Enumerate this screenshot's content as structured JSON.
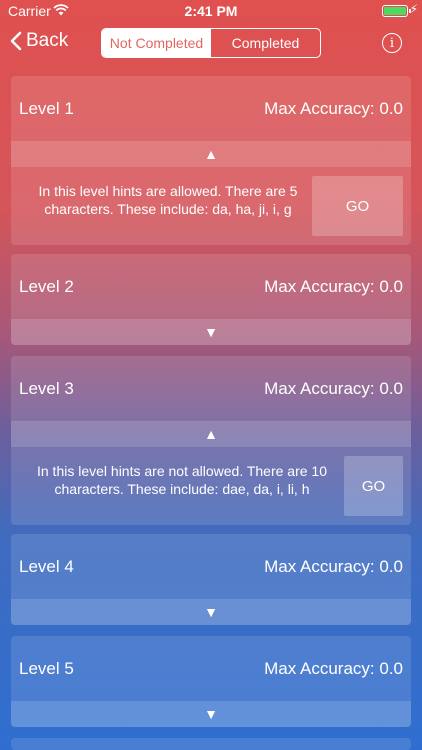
{
  "status_bar": {
    "carrier": "Carrier",
    "time": "2:41 PM"
  },
  "nav": {
    "back_label": "Back",
    "segments": [
      "Not Completed",
      "Completed"
    ],
    "info_symbol": "i"
  },
  "levels": [
    {
      "title": "Level 1",
      "accuracy": "Max Accuracy: 0.0",
      "arrow": "▲",
      "description_line1": "In this level hints are allowed. There are 5",
      "description_line2": "characters. These include: da, ha, ji, i, g",
      "go_label": "GO"
    },
    {
      "title": "Level 2",
      "accuracy": "Max Accuracy: 0.0",
      "arrow": "▼"
    },
    {
      "title": "Level 3",
      "accuracy": "Max Accuracy: 0.0",
      "arrow": "▲",
      "description_line1": "In this level hints are not allowed. There are 10",
      "description_line2": "characters. These include: dae, da, i, li, h",
      "go_label": "GO"
    },
    {
      "title": "Level 4",
      "accuracy": "Max Accuracy: 0.0",
      "arrow": "▼"
    },
    {
      "title": "Level 5",
      "accuracy": "Max Accuracy: 0.0",
      "arrow": "▼"
    }
  ],
  "colors": {
    "accent": "#e2675f",
    "battery": "#4cd964"
  }
}
